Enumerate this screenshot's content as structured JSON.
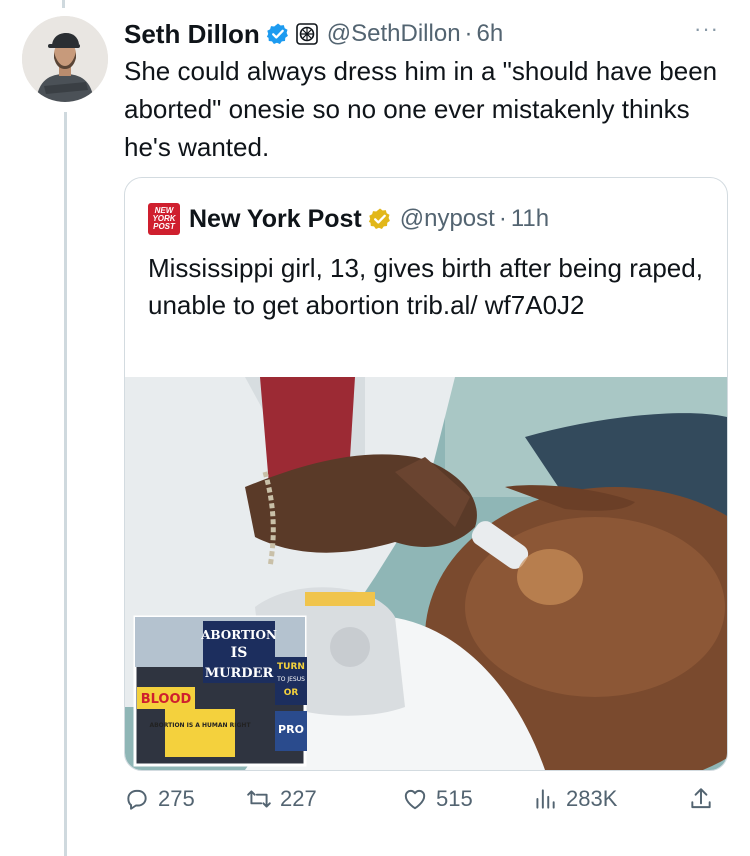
{
  "tweet": {
    "author_name": "Seth Dillon",
    "handle": "@SethDillon",
    "separator": "·",
    "time": "6h",
    "more": "···",
    "text": "She could always dress him in a \"should have been aborted\" onesie so no one ever mistakenly thinks he's wanted.",
    "icons": [
      "verified-badge-icon",
      "affiliate-icon",
      "more-icon"
    ]
  },
  "quote": {
    "logo_text": [
      "NEW",
      "YORK",
      "POST"
    ],
    "author_name": "New York Post",
    "handle": "@nypost",
    "separator": "·",
    "time": "11h",
    "text": "Mississippi girl, 13, gives birth after being raped, unable to get abortion trib.al/ wf7A0J2",
    "media": {
      "inset_signs": [
        "ABORTION",
        "IS",
        "MURDER",
        "BLOOD",
        "TURN",
        "TO JESUS",
        "OR",
        "ABORTION IS A HUMAN RIGHT",
        "PRO"
      ]
    },
    "colors": {
      "verified_gold": "#e2b719",
      "logo_red": "#cf1f2e"
    }
  },
  "actions": {
    "reply_count": "275",
    "retweet_count": "227",
    "like_count": "515",
    "view_count": "283K"
  },
  "colors": {
    "verified_blue": "#1d9bf0",
    "muted": "#536471",
    "border": "#d3dbe0"
  }
}
